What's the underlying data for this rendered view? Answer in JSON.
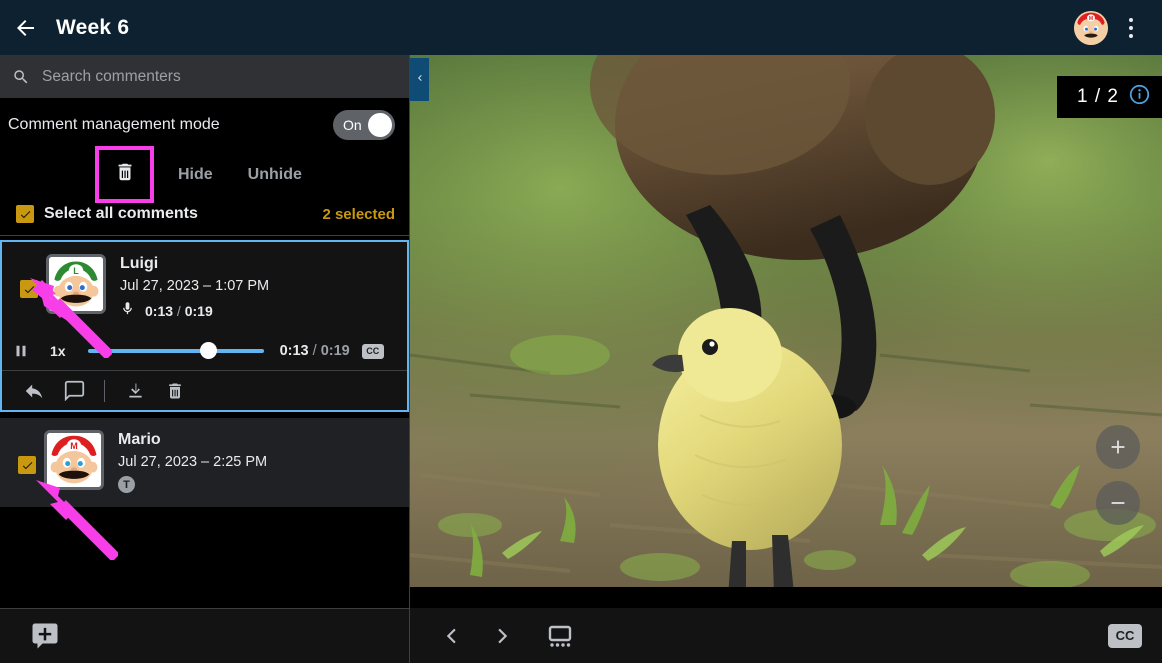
{
  "header": {
    "back_icon": "arrow-left-icon",
    "title": "Week 6",
    "avatar_icon": "mario-avatar",
    "menu_icon": "kebab-menu-icon"
  },
  "search": {
    "icon": "search-icon",
    "placeholder": "Search commenters",
    "value": ""
  },
  "management": {
    "label": "Comment management mode",
    "toggle_state": "On",
    "actions": {
      "delete_icon": "trash-icon",
      "hide_label": "Hide",
      "unhide_label": "Unhide"
    },
    "select_all_label": "Select all comments",
    "selected_count": "2 selected",
    "accent_color": "#c99811",
    "highlight_color": "#f73ee8"
  },
  "comments": [
    {
      "name": "Luigi",
      "date": "Jul 27, 2023 – 1:07 PM",
      "type_icon": "microphone-icon",
      "duration": "0:13",
      "duration_sep": "/",
      "total": "0:19",
      "selected": true,
      "avatar_icon": "luigi-avatar",
      "player": {
        "play_icon": "pause-icon",
        "speed": "1x",
        "current": "0:13",
        "sep": "/",
        "total": "0:19",
        "cc_label": "CC",
        "progress_percent": 64
      },
      "toolbar": {
        "reply_icon": "reply-arrow-icon",
        "comment_icon": "comment-bubble-icon",
        "download_icon": "download-icon",
        "delete_icon": "trash-icon"
      }
    },
    {
      "name": "Mario",
      "date": "Jul 27, 2023 – 2:25 PM",
      "type_icon": "text-comment-icon",
      "type_badge": "T",
      "selected": true,
      "avatar_icon": "mario-avatar"
    }
  ],
  "panel_bottom": {
    "add_comment_icon": "add-comment-icon"
  },
  "collapse_tab": {
    "icon": "chevron-left-icon",
    "color": "#0f4c75"
  },
  "viewer": {
    "page_indicator": "1 / 2",
    "info_icon": "info-icon",
    "zoom_in_icon": "zoom-in-icon",
    "zoom_out_icon": "zoom-out-icon",
    "photo_alt": "gosling-and-goose-photo",
    "bottom_bar": {
      "prev_icon": "chevron-left-icon",
      "next_icon": "chevron-right-icon",
      "thumbnails_icon": "filmstrip-view-icon",
      "cc_label": "CC"
    }
  },
  "annotations": {
    "arrow_color": "#f73ee8",
    "arrow_1": "arrow-pointing-to-luigi-checkbox",
    "arrow_2": "arrow-pointing-to-mario-checkbox"
  }
}
